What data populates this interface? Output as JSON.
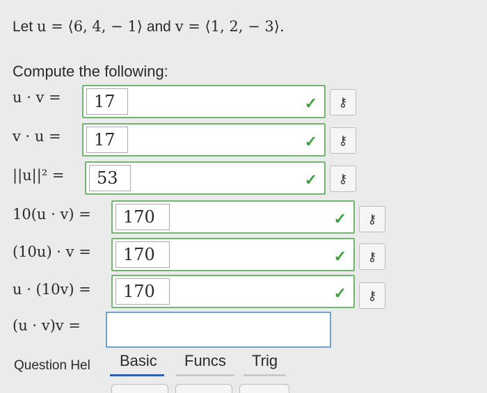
{
  "question": {
    "prefix": "Let",
    "u_def": "u = ⟨6, 4, − 1⟩",
    "and": "and",
    "v_def": "v = ⟨1, 2, − 3⟩."
  },
  "subheading": "Compute the following:",
  "rows": [
    {
      "label": "u · v =",
      "value": "17",
      "status": "correct"
    },
    {
      "label": "v · u =",
      "value": "17",
      "status": "correct"
    },
    {
      "label": "||u||² =",
      "value": "53",
      "status": "correct"
    },
    {
      "label": "10(u · v) =",
      "value": "170",
      "status": "correct"
    },
    {
      "label": "(10u) · v =",
      "value": "170",
      "status": "correct"
    },
    {
      "label": "u · (10v) =",
      "value": "170",
      "status": "correct"
    },
    {
      "label": "(u · v)v =",
      "value": "",
      "status": "empty"
    }
  ],
  "key_icon": "key-icon",
  "check_icon": "check-icon",
  "question_help": "Question Hel",
  "tabs": [
    "Basic",
    "Funcs",
    "Trig"
  ],
  "colors": {
    "correct": "#6db86d",
    "active_input": "#6fa3cc",
    "tab_active": "#2f5fb3"
  }
}
